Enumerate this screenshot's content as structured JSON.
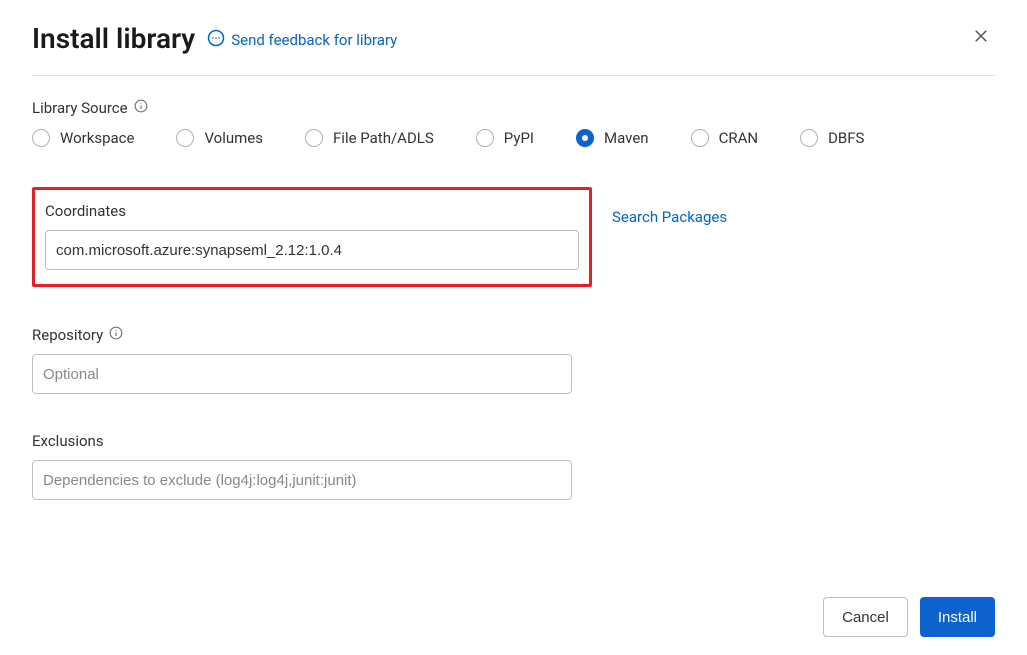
{
  "dialog": {
    "title": "Install library",
    "feedback_label": "Send feedback for library"
  },
  "library_source": {
    "label": "Library Source",
    "options": [
      {
        "label": "Workspace",
        "selected": false
      },
      {
        "label": "Volumes",
        "selected": false
      },
      {
        "label": "File Path/ADLS",
        "selected": false
      },
      {
        "label": "PyPI",
        "selected": false
      },
      {
        "label": "Maven",
        "selected": true
      },
      {
        "label": "CRAN",
        "selected": false
      },
      {
        "label": "DBFS",
        "selected": false
      }
    ]
  },
  "coordinates": {
    "label": "Coordinates",
    "value": "com.microsoft.azure:synapseml_2.12:1.0.4",
    "search_link": "Search Packages"
  },
  "repository": {
    "label": "Repository",
    "placeholder": "Optional",
    "value": ""
  },
  "exclusions": {
    "label": "Exclusions",
    "placeholder": "Dependencies to exclude (log4j:log4j,junit:junit)",
    "value": ""
  },
  "footer": {
    "cancel": "Cancel",
    "install": "Install"
  }
}
